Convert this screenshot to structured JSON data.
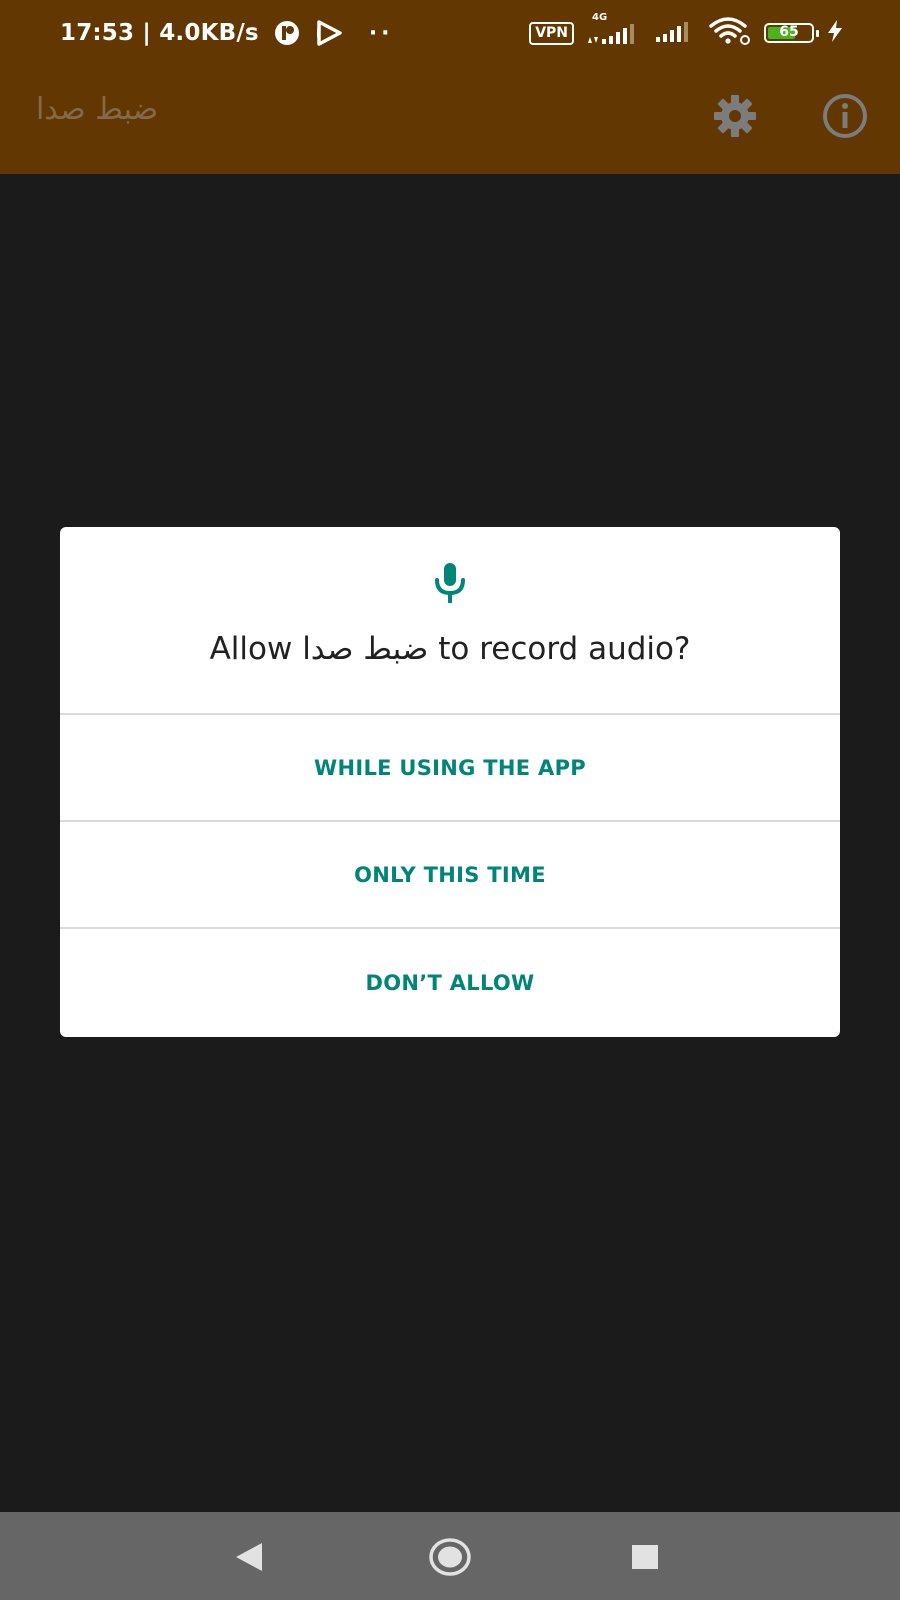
{
  "status_bar": {
    "time_speed": "17:53 | 4.0KB/s",
    "dots": "··",
    "vpn_label": "VPN",
    "network_tag": "4G",
    "battery_level": "65",
    "battery_fraction": 0.65,
    "icons": [
      "notification-app-icon",
      "play-icon",
      "signal-4g-icon",
      "signal-icon",
      "wifi-icon",
      "battery-icon",
      "charging-icon"
    ]
  },
  "app_bar": {
    "title": "ضبط صدا",
    "actions": [
      "settings-icon",
      "info-icon"
    ]
  },
  "dialog": {
    "icon": "microphone-icon",
    "title": "Allow ضبط صدا to record audio?",
    "options": [
      {
        "label": "WHILE USING THE APP"
      },
      {
        "label": "ONLY THIS TIME"
      },
      {
        "label": "DON’T ALLOW"
      }
    ]
  },
  "nav_bar": {
    "buttons": [
      "back-icon",
      "home-icon",
      "recents-icon"
    ]
  },
  "colors": {
    "app_bar": "#623701",
    "background": "#1b1b1b",
    "accent": "#018577",
    "dialog_bg": "#ffffff",
    "nav_bar": "#666666",
    "battery_fill": "#4cb320"
  }
}
